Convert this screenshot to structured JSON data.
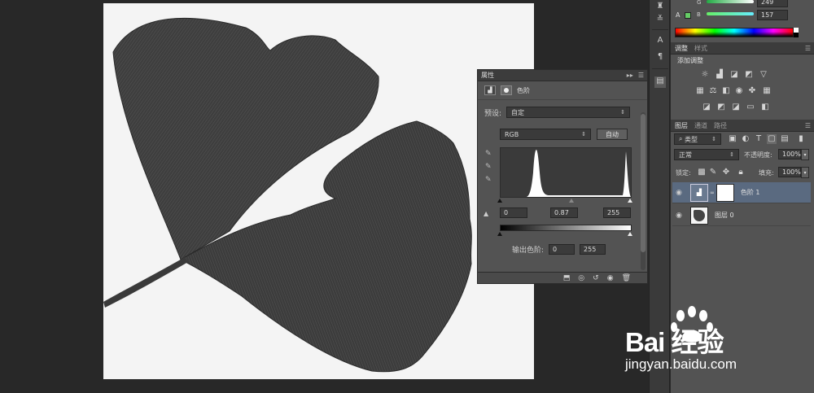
{
  "properties": {
    "tab_label": "属性",
    "type_label": "色阶",
    "preset_label": "预设:",
    "preset_value": "自定",
    "channel_value": "RGB",
    "auto_button": "自动",
    "input_black": "0",
    "input_gamma": "0.87",
    "input_white": "255",
    "output_label": "输出色阶:",
    "output_black": "0",
    "output_white": "255"
  },
  "color_panel": {
    "g_label": "G",
    "g_value": "249",
    "b_label": "B",
    "b_value": "157"
  },
  "adjustments": {
    "tabs": [
      "调整",
      "样式"
    ],
    "add_label": "添加调整"
  },
  "layers": {
    "tabs": [
      "图层",
      "通道",
      "路径"
    ],
    "filter_value": "类型",
    "blend_mode": "正常",
    "opacity_label": "不透明度:",
    "opacity_value": "100%",
    "lock_label": "锁定:",
    "fill_label": "填充:",
    "fill_value": "100%",
    "items": [
      {
        "name": "色阶 1",
        "selected": true
      },
      {
        "name": "图层 0",
        "selected": false
      }
    ]
  },
  "watermark": {
    "brand": "Bai 经验",
    "site": "jingyan.baidu.com"
  },
  "icons": [
    "eyedropper-icon",
    "eye-icon",
    "chain-link-icon",
    "trash-icon",
    "reset-icon",
    "levels-icon",
    "mask-icon",
    "lock-icon",
    "paw-icon"
  ]
}
